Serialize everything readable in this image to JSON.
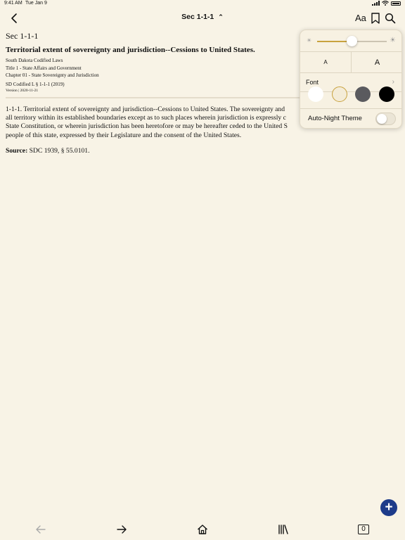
{
  "status": {
    "time": "9:41 AM",
    "date": "Tue Jan 9"
  },
  "navbar": {
    "title": "Sec 1-1-1",
    "font_button": "Aa"
  },
  "document": {
    "section": "Sec 1-1-1",
    "heading": "Territorial extent of sovereignty and jurisdiction--Cessions to United States.",
    "meta": [
      "South Dakota Codified Laws",
      "Title 1 - State Affairs and Government",
      "Chapter 01 - State Sovereignty and Jurisdiction"
    ],
    "citation": "SD Codified L § 1-1-1 (2019)",
    "version": "Version | 2020-11-21",
    "body_lines": [
      "1-1-1. Territorial extent of sovereignty and jurisdiction--Cessions to United States. The sovereignty and",
      "all territory within its established boundaries except as to such places wherein jurisdiction is expressly c",
      "State Constitution, or wherein jurisdiction has been heretofore or may be hereafter ceded to the United S",
      "people of this state, expressed by their Legislature and the consent of the United States."
    ],
    "source_label": "Source:",
    "source_text": " SDC 1939, § 55.0101."
  },
  "popover": {
    "brightness": 0.5,
    "font_small": "A",
    "font_large": "A",
    "font_label": "Font",
    "themes": [
      {
        "name": "white",
        "color": "#ffffff"
      },
      {
        "name": "sepia",
        "color": "#f4ecd8",
        "selected": true
      },
      {
        "name": "gray",
        "color": "#5a5a5e"
      },
      {
        "name": "black",
        "color": "#000000"
      }
    ],
    "auto_night_label": "Auto-Night Theme",
    "auto_night_on": false
  },
  "colors": {
    "accent": "#c8a23e",
    "fab": "#1d3b8a",
    "background": "#f8f3e6"
  },
  "toolbar": {
    "counter": "0"
  }
}
